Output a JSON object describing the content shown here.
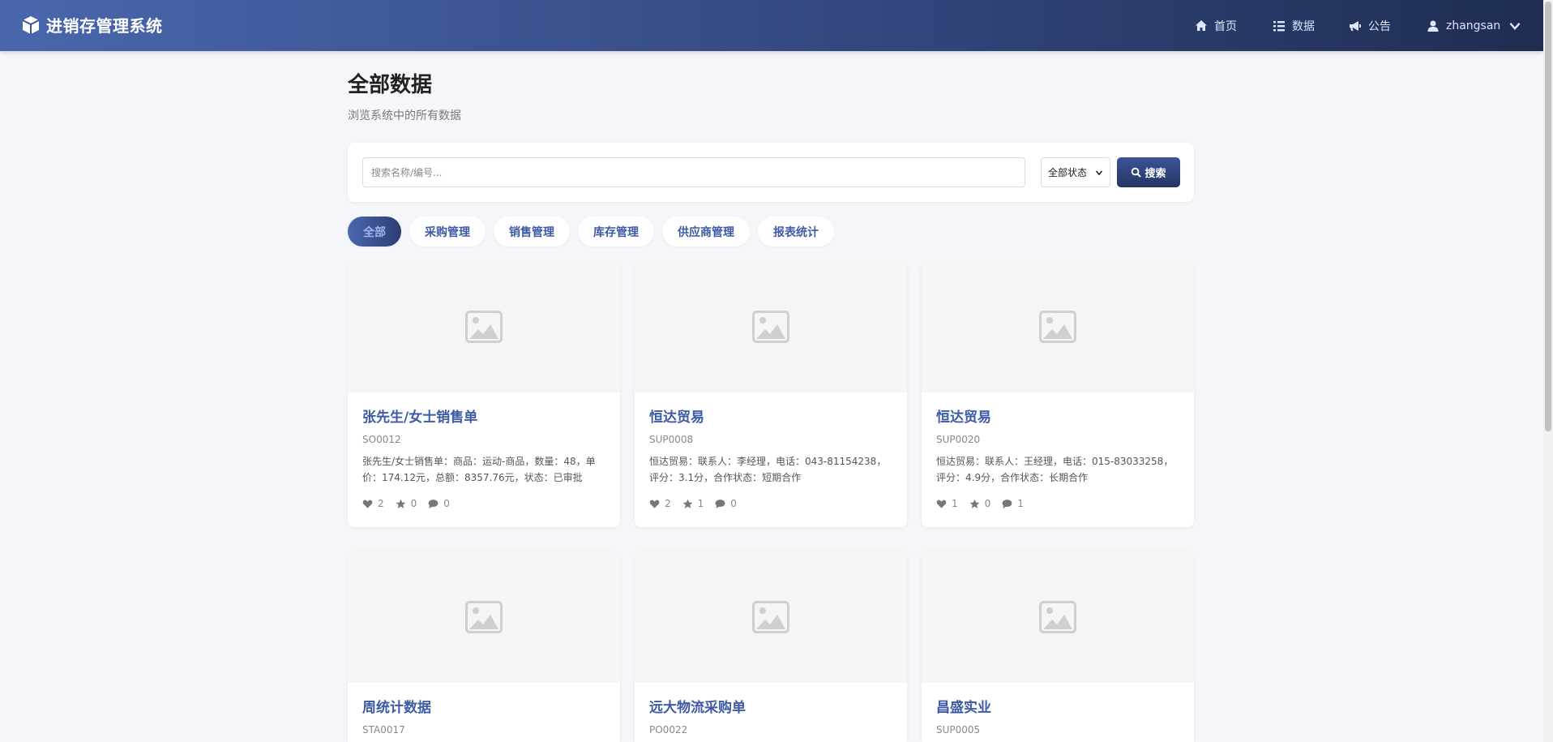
{
  "app": {
    "title": "进销存管理系统"
  },
  "nav": {
    "home": "首页",
    "data": "数据",
    "notice": "公告",
    "user": "zhangsan"
  },
  "page": {
    "title": "全部数据",
    "subtitle": "浏览系统中的所有数据"
  },
  "search": {
    "placeholder": "搜索名称/编号...",
    "status_selected": "全部状态",
    "button": "搜索"
  },
  "tabs": [
    "全部",
    "采购管理",
    "销售管理",
    "库存管理",
    "供应商管理",
    "报表统计"
  ],
  "cards": [
    {
      "title": "张先生/女士销售单",
      "code": "SO0012",
      "desc": "张先生/女士销售单：商品：运动-商品，数量：48，单价：174.12元，总额：8357.76元，状态：已审批",
      "likes": "2",
      "stars": "0",
      "comments": "0"
    },
    {
      "title": "恒达贸易",
      "code": "SUP0008",
      "desc": "恒达贸易：联系人：李经理，电话：043-81154238，评分：3.1分，合作状态：短期合作",
      "likes": "2",
      "stars": "1",
      "comments": "0"
    },
    {
      "title": "恒达贸易",
      "code": "SUP0020",
      "desc": "恒达贸易：联系人：王经理，电话：015-83033258，评分：4.9分，合作状态：长期合作",
      "likes": "1",
      "stars": "0",
      "comments": "1"
    },
    {
      "title": "周统计数据",
      "code": "STA0017",
      "desc": "",
      "likes": "",
      "stars": "",
      "comments": ""
    },
    {
      "title": "远大物流采购单",
      "code": "PO0022",
      "desc": "",
      "likes": "",
      "stars": "",
      "comments": ""
    },
    {
      "title": "昌盛实业",
      "code": "SUP0005",
      "desc": "",
      "likes": "",
      "stars": "",
      "comments": ""
    }
  ],
  "colors": {
    "accent": "#3d5aa5",
    "navbar_start": "#4a67ad",
    "navbar_end": "#1f2d52"
  }
}
